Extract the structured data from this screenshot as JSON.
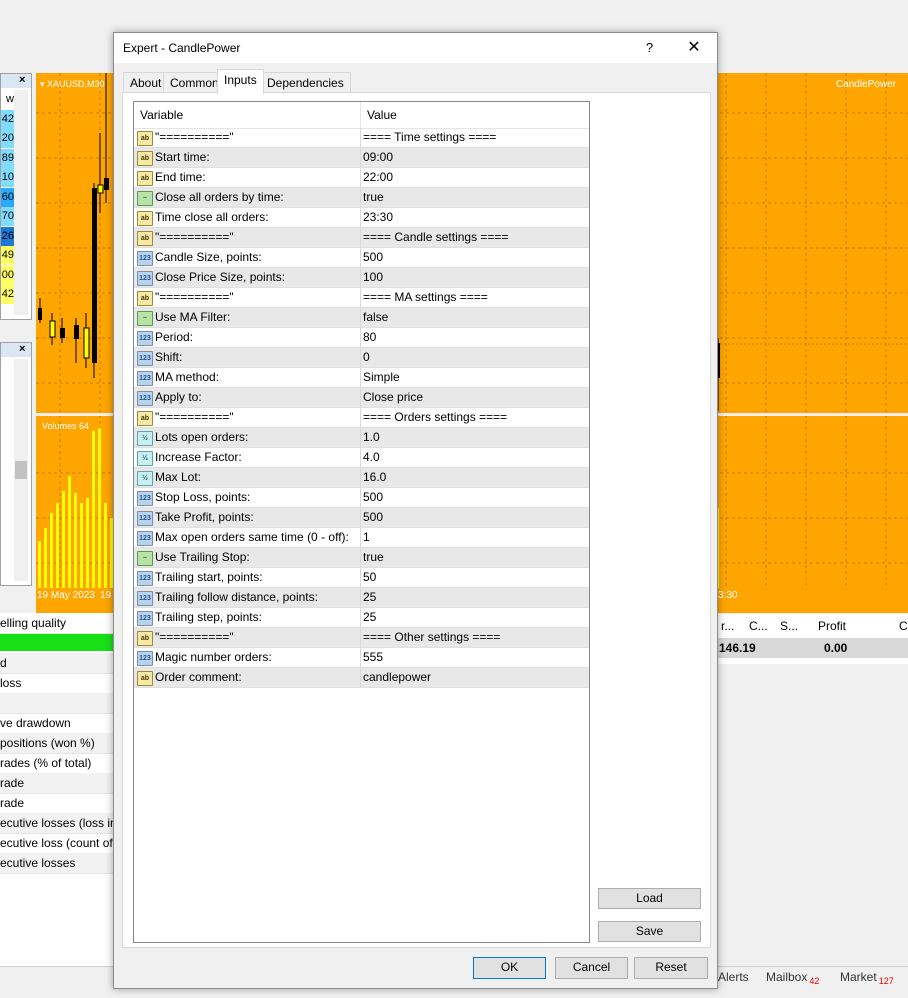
{
  "background": {
    "market_watch_values": [
      "w",
      "42",
      "20",
      "89",
      "10",
      "60",
      "70",
      "26",
      "49",
      "00",
      "42"
    ],
    "chart_symbol": "XAUUSD,M30",
    "chart_ea_name": "CandlePower",
    "volumes_label": "Volumes 64",
    "chart_date_left": "19 May 2023",
    "chart_date_left2": "19",
    "chart_time_right": "3:30",
    "left_table_rows": [
      "elling quality",
      "",
      "d",
      " loss",
      "",
      "ve drawdown",
      "positions (won %)",
      "rades (% of total)",
      "rade",
      "rade",
      "ecutive losses (loss in n",
      "ecutive loss (count of l",
      "ecutive losses"
    ],
    "right_table_headers": [
      "r...",
      "C...",
      "S...",
      "Profit",
      "C"
    ],
    "right_table_values": [
      "146.19",
      "0.00"
    ],
    "status_tabs": [
      {
        "label": "Alerts",
        "badge": ""
      },
      {
        "label": "Mailbox",
        "badge": "42"
      },
      {
        "label": "Market",
        "badge": "127"
      }
    ]
  },
  "dialog": {
    "title": "Expert - CandlePower",
    "help_label": "?",
    "close_label": "✕",
    "tabs": [
      "About",
      "Common",
      "Inputs",
      "Dependencies"
    ],
    "active_tab": "Inputs",
    "grid_headers": {
      "variable": "Variable",
      "value": "Value"
    },
    "rows": [
      {
        "type": "str",
        "variable": "\"==========\"",
        "value": "==== Time settings ===="
      },
      {
        "type": "str",
        "variable": "Start time:",
        "value": "09:00"
      },
      {
        "type": "str",
        "variable": "End time:",
        "value": "22:00"
      },
      {
        "type": "bool",
        "variable": "Close all orders by time:",
        "value": "true"
      },
      {
        "type": "str",
        "variable": "Time close all orders:",
        "value": "23:30"
      },
      {
        "type": "str",
        "variable": "\"==========\"",
        "value": "==== Candle settings ===="
      },
      {
        "type": "int",
        "variable": "Candle Size, points:",
        "value": "500"
      },
      {
        "type": "int",
        "variable": "Close Price Size, points:",
        "value": "100"
      },
      {
        "type": "str",
        "variable": "\"==========\"",
        "value": "==== MA settings ===="
      },
      {
        "type": "bool",
        "variable": "Use MA Filter:",
        "value": "false"
      },
      {
        "type": "int",
        "variable": "Period:",
        "value": "80"
      },
      {
        "type": "int",
        "variable": "Shift:",
        "value": "0"
      },
      {
        "type": "int",
        "variable": "MA method:",
        "value": "Simple"
      },
      {
        "type": "int",
        "variable": "Apply to:",
        "value": "Close price"
      },
      {
        "type": "str",
        "variable": "\"==========\"",
        "value": "==== Orders settings ===="
      },
      {
        "type": "dbl",
        "variable": "Lots open orders:",
        "value": "1.0"
      },
      {
        "type": "dbl",
        "variable": "Increase Factor:",
        "value": "4.0"
      },
      {
        "type": "dbl",
        "variable": "Max Lot:",
        "value": "16.0"
      },
      {
        "type": "int",
        "variable": "Stop Loss, points:",
        "value": "500"
      },
      {
        "type": "int",
        "variable": "Take Profit, points:",
        "value": "500"
      },
      {
        "type": "int",
        "variable": "Max open orders same time (0 - off):",
        "value": "1"
      },
      {
        "type": "bool",
        "variable": "Use Trailing Stop:",
        "value": "true"
      },
      {
        "type": "int",
        "variable": "Trailing start, points:",
        "value": "50"
      },
      {
        "type": "int",
        "variable": "Trailing follow distance, points:",
        "value": "25"
      },
      {
        "type": "int",
        "variable": "Trailing step, points:",
        "value": "25"
      },
      {
        "type": "str",
        "variable": "\"==========\"",
        "value": "==== Other settings ===="
      },
      {
        "type": "int",
        "variable": "Magic number orders:",
        "value": "555"
      },
      {
        "type": "str",
        "variable": "Order comment:",
        "value": "candlepower"
      }
    ],
    "icon_glyphs": {
      "str": "ab",
      "int": "123",
      "bool": "~",
      "dbl": "½"
    },
    "side_buttons": {
      "load": "Load",
      "save": "Save"
    },
    "footer_buttons": {
      "ok": "OK",
      "cancel": "Cancel",
      "reset": "Reset"
    }
  },
  "colors": {
    "chart_bg": "#ffa500",
    "volume_bar": "#ffff00",
    "ok_border": "#0078d7"
  }
}
